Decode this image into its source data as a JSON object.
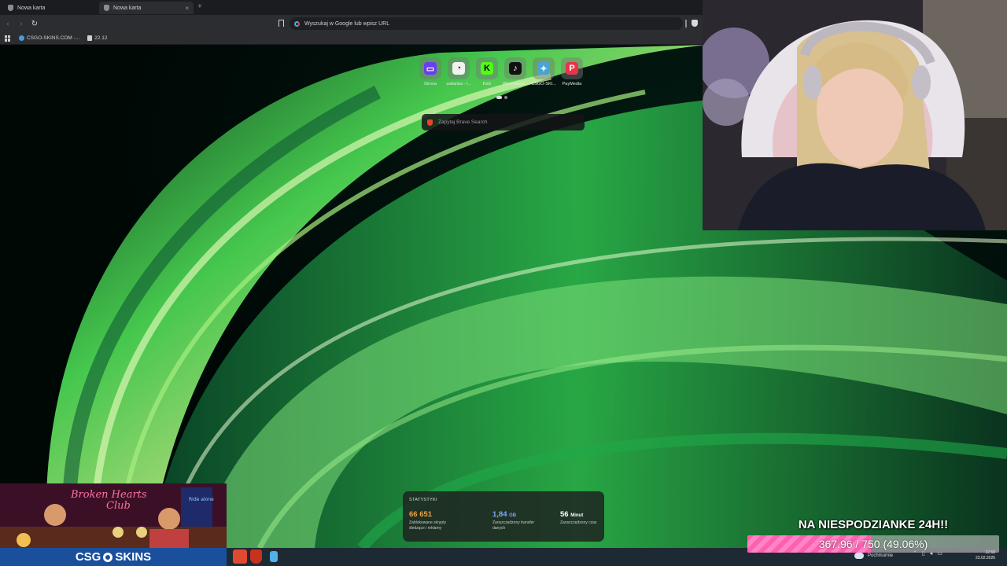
{
  "browser": {
    "tabs": [
      {
        "label": "Nowa karta",
        "active": false
      },
      {
        "label": "Nowa karta",
        "active": true
      }
    ],
    "new_tab_symbol": "+",
    "close_symbol": "×",
    "back_symbol": "‹",
    "forward_symbol": "›",
    "reload_symbol": "↻",
    "url_placeholder": "Wyszukaj w Google lub wpisz URL",
    "bookmarks": [
      {
        "label": "CSGO-SKINS.COM -...",
        "icon": "globe-icon"
      },
      {
        "label": "22.12",
        "icon": "file-icon"
      }
    ]
  },
  "newtab": {
    "shortcuts": [
      {
        "label": "Strona",
        "glyph": "▭",
        "color": "#6a3df0"
      },
      {
        "label": "zadanka - l...",
        "glyph": "◔",
        "color": "#f2f2f2"
      },
      {
        "label": "Kick",
        "glyph": "K",
        "color": "#53fc18"
      },
      {
        "label": "Wyszukiwa...",
        "glyph": "♪",
        "color": "#111111"
      },
      {
        "label": "CSGO-SKI...",
        "glyph": "✦",
        "color": "#4aa3d6"
      },
      {
        "label": "PayMedia",
        "glyph": "P",
        "color": "#e8334a"
      }
    ],
    "search_placeholder": "Zapytaj Brave Search"
  },
  "stats": {
    "title": "STATYSTYKI",
    "items": [
      {
        "value": "66 651",
        "unit": "",
        "desc": "Zablokowane skrypty śledzące i reklamy",
        "color": "#f0a040"
      },
      {
        "value": "1,84",
        "unit": "GB",
        "desc": "Zaoszczędzony transfer danych",
        "color": "#7ea6ff"
      },
      {
        "value": "56",
        "unit": "Minut",
        "desc": "Zaoszczędzony czas",
        "color": "#ffffff"
      }
    ]
  },
  "banner": {
    "neon_text": "Broken Hearts Club",
    "sign_text": "Ride alone",
    "brand_left": "CSG",
    "brand_right": "SKINS"
  },
  "goal": {
    "title": "NA NIESPODZIANKE 24H!!",
    "text": "367.96 / 750 (49.06%)",
    "current": 367.96,
    "target": 750,
    "fraction": 0.4906
  },
  "taskbar": {
    "weather_label": "Pochmurnie",
    "time": "22:58",
    "date": "23.02.2026",
    "apps": [
      "paint-app-icon",
      "brave-app-icon",
      "notepad-app-icon"
    ]
  },
  "colors": {
    "accent_green": "#3ad66a",
    "goal_pink": "#ff5fb1",
    "banner_blue": "#1a4f9c"
  }
}
